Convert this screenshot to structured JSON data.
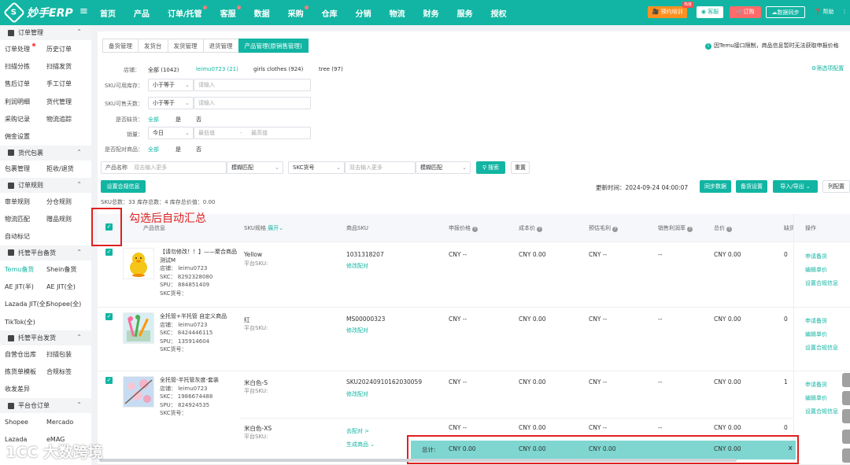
{
  "app": {
    "logo_text": "妙手ERP",
    "logo_mark": "S"
  },
  "nav": [
    "首页",
    "产品",
    "订单/托管",
    "客服",
    "数据",
    "采购",
    "仓库",
    "分销",
    "物流",
    "财务",
    "服务",
    "授权"
  ],
  "topbar": {
    "training": "预约培训",
    "training_badge": "热度",
    "service": "客服",
    "order": "订购",
    "sync": "数据同步",
    "help": "帮助",
    "more": "⋮"
  },
  "sidebar": {
    "groups": [
      {
        "title": "订单管理",
        "rows": [
          [
            "订单处理",
            "历史订单"
          ],
          [
            "扫描分拣",
            "扫描发货"
          ],
          [
            "售后订单",
            "手工订单"
          ],
          [
            "利润明细",
            "货代管理"
          ],
          [
            "采购记录",
            "物流追踪"
          ],
          [
            "佣金设置",
            ""
          ]
        ]
      },
      {
        "title": "货代包裹",
        "rows": [
          [
            "包裹管理",
            "拒收/退货"
          ]
        ]
      },
      {
        "title": "订单规则",
        "rows": [
          [
            "审单规则",
            "分仓规则"
          ],
          [
            "物流匹配",
            "赠品规则"
          ],
          [
            "自动标记",
            ""
          ]
        ]
      },
      {
        "title": "托管平台备货",
        "rows": [
          [
            "Temu备货",
            "Shein备货"
          ],
          [
            "AE JIT(半)",
            "AE JIT(全)"
          ],
          [
            "Lazada JIT(全)",
            "Shopee(全)"
          ],
          [
            "TikTok(全)",
            ""
          ]
        ]
      },
      {
        "title": "托管平台发货",
        "rows": [
          [
            "自营仓出库",
            "扫描包装"
          ],
          [
            "拣货单模板",
            "合规标签"
          ],
          [
            "收发差异",
            ""
          ]
        ]
      },
      {
        "title": "平台仓订单",
        "rows": [
          [
            "Shopee",
            "Mercado"
          ],
          [
            "Lazada",
            "eMAG"
          ]
        ]
      }
    ]
  },
  "tabs": [
    "备货管理",
    "发货台",
    "发货管理",
    "退货管理",
    "产品管理(原销售管理)"
  ],
  "notice": "因Temu接口限制，商品信息暂时无法获取申报价格",
  "filter_settings": "筛选项配置",
  "filters": {
    "store_label": "店铺：",
    "stores": [
      "全部 (1042)",
      "leimu0723 (21)",
      "girls clothes (924)",
      "tree (97)"
    ],
    "sku_stock_label": "SKU可用库存：",
    "sku_days_label": "SKU可售天数：",
    "compare": "小于等于",
    "input_ph": "请输入",
    "oos_label": "是否缺货：",
    "sales_label": "销量：",
    "sales_period": "今日",
    "min_ph": "最低值",
    "max_ph": "最高值",
    "dash": "-",
    "match_label": "是否配对商品：",
    "opt_all": "全部",
    "opt_yes": "是",
    "opt_no": "否",
    "product_name_label": "产品名称",
    "multi_ph": "双击输入更多",
    "fuzzy": "模糊匹配",
    "skc_label": "SKC货号",
    "search": "搜索",
    "reset": "重置"
  },
  "toolbar": {
    "compliance": "设置合规信息",
    "update_time": "更新时间：2024-09-24 04:00:07",
    "sync": "同步数据",
    "stock_settings": "备货设置",
    "import_export": "导入/导出",
    "column_config": "列配置"
  },
  "stats": {
    "text": "SKU总数：33    库存总数：4    库存总价值：0.00"
  },
  "table": {
    "headers": {
      "product": "产品信息",
      "sku_spec": "SKU规格",
      "expand": "展开",
      "product_sku": "商品SKU",
      "declare_price": "申报价格",
      "cost": "成本价",
      "est_profit": "预估毛利",
      "margin": "销售利润率",
      "total": "总价",
      "shortage": "缺货",
      "ops": "操作"
    },
    "rows": [
      {
        "title": "【请勿修改！！】——聚合商品测试M",
        "store": "店铺：  leimu0723",
        "skc": "SKC：  8292328080",
        "spu": "SPU：  884851409",
        "skcno": "SKC货号：",
        "spec": "Yellow",
        "platsku": "平台SKU:",
        "psku": "1031318207",
        "pair": "修改配对",
        "declare": "CNY --",
        "cost": "CNY 0.00",
        "profit": "CNY --",
        "margin": "--",
        "total": "CNY 0.00",
        "short": "0"
      },
      {
        "title": "全托管+半托管 自定义商品",
        "store": "店铺：  leimu0723",
        "skc": "SKC：  8424446115",
        "spu": "SPU：  135914604",
        "skcno": "SKC货号：",
        "spec": "红",
        "platsku": "平台SKU:",
        "psku": "MS00000323",
        "pair": "修改配对",
        "declare": "CNY --",
        "cost": "CNY 0.00",
        "profit": "CNY --",
        "margin": "--",
        "total": "CNY 0.00",
        "short": "0"
      },
      {
        "title": "全托管-半托管灰度-套装",
        "store": "店铺：  leimu0723",
        "skc": "SKC：  1986674488",
        "spu": "SPU：  824924535",
        "skcno": "SKC货号：",
        "spec": "米白色-S",
        "platsku": "平台SKU:",
        "psku": "SKU20240910162030059",
        "pair": "修改配对",
        "declare": "CNY --",
        "cost": "CNY 0.00",
        "profit": "CNY --",
        "margin": "--",
        "total": "CNY 0.00",
        "short": "1"
      },
      {
        "spec": "米白色-XS",
        "platsku": "平台SKU:",
        "pair_go": "去配对 >",
        "gen": "生成商品",
        "declare": "CNY --",
        "cost": "CNY 0.00",
        "profit": "CNY --",
        "margin": "--",
        "total": "CNY 0.00",
        "short": "0"
      }
    ],
    "ops": [
      "申请备货",
      "编辑单价",
      "设置合规信息"
    ]
  },
  "total_bar": {
    "label": "总计:",
    "declare": "CNY 0.00",
    "cost": "CNY 0.00",
    "profit": "CNY 0.00",
    "total": "CNY 0.00",
    "close": "x"
  },
  "annotation": "勾选后自动汇总",
  "watermark": "1CC 大数跨境"
}
